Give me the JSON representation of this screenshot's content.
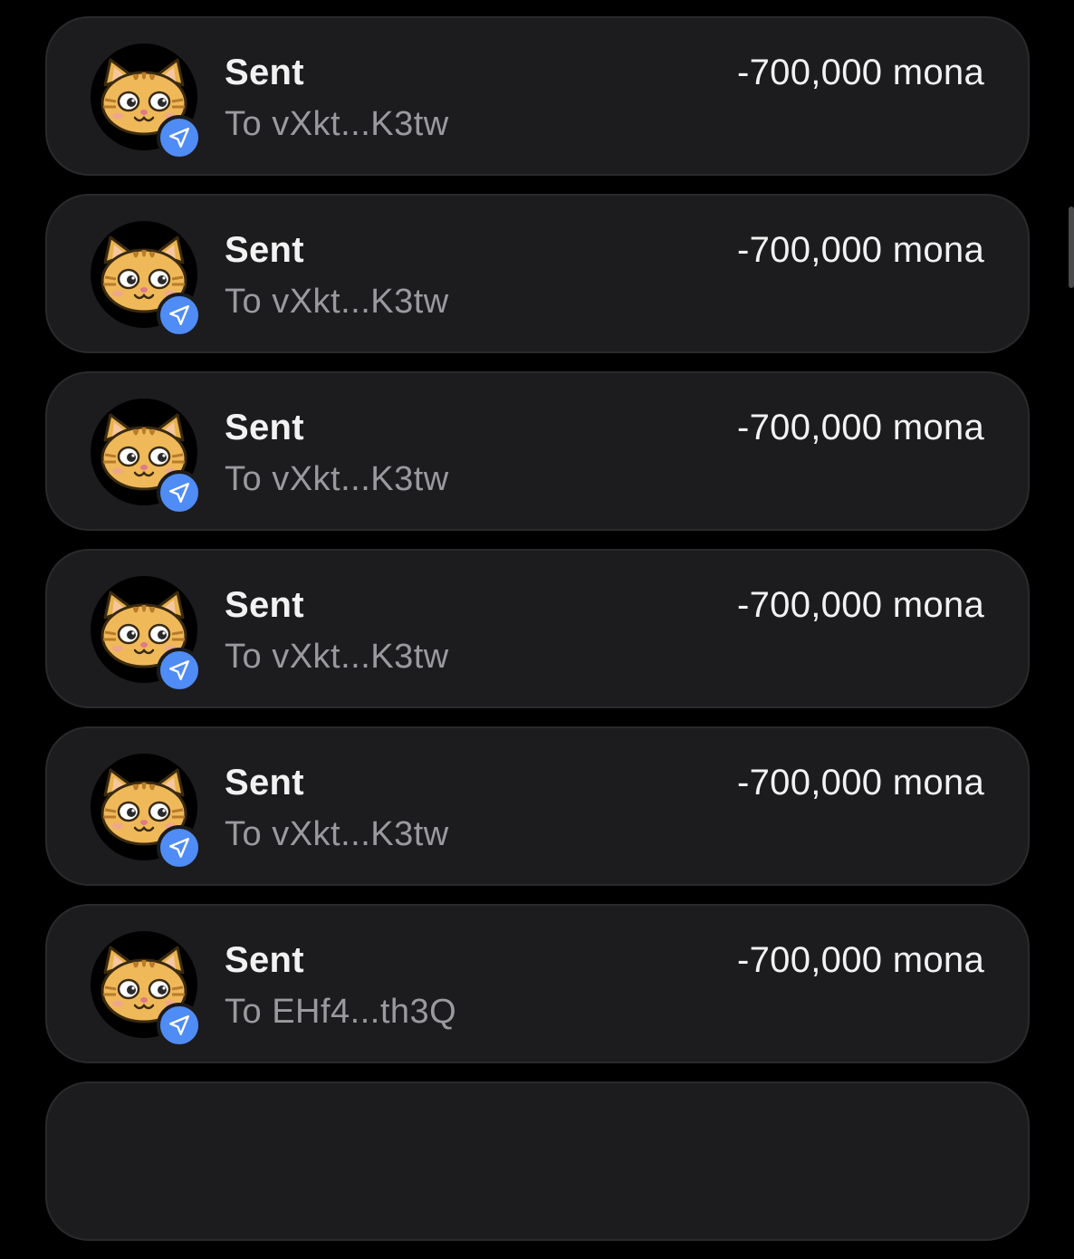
{
  "transactions": [
    {
      "title": "Sent",
      "subtitle": "To vXkt...K3tw",
      "amount": "-700,000 mona"
    },
    {
      "title": "Sent",
      "subtitle": "To vXkt...K3tw",
      "amount": "-700,000 mona"
    },
    {
      "title": "Sent",
      "subtitle": "To vXkt...K3tw",
      "amount": "-700,000 mona"
    },
    {
      "title": "Sent",
      "subtitle": "To vXkt...K3tw",
      "amount": "-700,000 mona"
    },
    {
      "title": "Sent",
      "subtitle": "To vXkt...K3tw",
      "amount": "-700,000 mona"
    },
    {
      "title": "Sent",
      "subtitle": "To EHf4...th3Q",
      "amount": "-700,000 mona"
    },
    {
      "title": "",
      "subtitle": "",
      "amount": ""
    }
  ],
  "icons": {
    "avatar": "cat-token-icon",
    "badge": "send-arrow-icon"
  },
  "colors": {
    "background": "#000000",
    "card": "#1c1c1e",
    "badge": "#4f8cf5",
    "subtitle": "#9a9a9e",
    "text": "#f2f2f2"
  }
}
